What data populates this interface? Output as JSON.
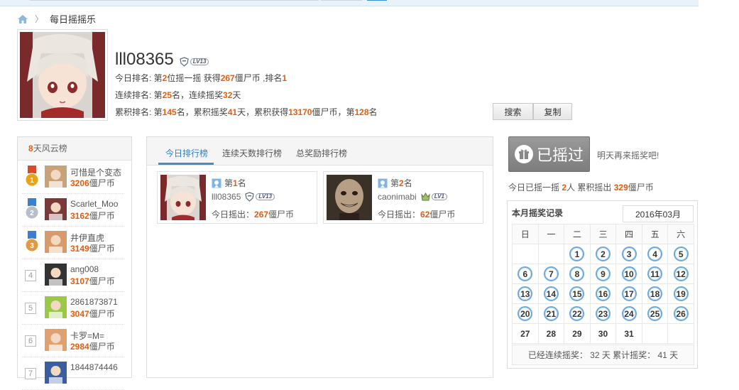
{
  "breadcrumb": {
    "current": "每日摇摇乐"
  },
  "profile": {
    "username": "lll08365",
    "level": "LV13",
    "today_rank_prefix": "今日排名: 第",
    "today_rank_pos": "2",
    "today_rank_mid": "位摇一摇 获得",
    "today_rank_coins": "267",
    "today_rank_suffix": "僵尸币 ,排名",
    "today_rank_no": "1",
    "streak_prefix": "连续排名: 第",
    "streak_rank": "25",
    "streak_mid": "名，连续摇奖",
    "streak_days": "32",
    "streak_suffix": "天",
    "total_prefix": "累积排名: 第",
    "total_rank": "145",
    "total_mid1": "名，累积摇奖",
    "total_days": "41",
    "total_mid2": "天，累积获得",
    "total_coins": "13170",
    "total_mid3": "僵尸币，第",
    "total_place": "128",
    "total_suffix": "名"
  },
  "buttons": {
    "search": "搜索",
    "copy": "复制"
  },
  "leaderboard": {
    "days": "8",
    "title_suffix": "天风云榜",
    "unit": "僵尸币",
    "items": [
      {
        "rank": "1",
        "name": "可惜是个变态",
        "coins": "3206",
        "medal": "gold"
      },
      {
        "rank": "2",
        "name": "Scarlet_Moo",
        "coins": "3162",
        "medal": "silver"
      },
      {
        "rank": "3",
        "name": "井伊直虎",
        "coins": "3149",
        "medal": "bronze"
      },
      {
        "rank": "4",
        "name": "ang008",
        "coins": "3107",
        "medal": ""
      },
      {
        "rank": "5",
        "name": "2861873871",
        "coins": "3047",
        "medal": ""
      },
      {
        "rank": "6",
        "name": "卡罗=M=",
        "coins": "2984",
        "medal": ""
      },
      {
        "rank": "7",
        "name": "1844874446",
        "coins": "",
        "medal": ""
      }
    ]
  },
  "tabs": {
    "today": "今日排行榜",
    "streak": "连续天数排行榜",
    "total": "总奖励排行榜"
  },
  "today_cards": [
    {
      "rank_prefix": "第",
      "rank": "1",
      "rank_suffix": "名",
      "name": "lll08365",
      "level": "LV13",
      "out_label": "今日摇出：",
      "coins": "267",
      "unit": "僵尸币"
    },
    {
      "rank_prefix": "第",
      "rank": "2",
      "rank_suffix": "名",
      "name": "caonimabi",
      "level": "LV1",
      "out_label": "今日摇出：",
      "coins": "62",
      "unit": "僵尸币"
    }
  ],
  "shake": {
    "done_label": "已摇过",
    "come_back": "明天再来摇奖吧!",
    "sum_prefix": "今日已摇一摇",
    "sum_people": "2",
    "sum_mid": "人 累积摇出",
    "sum_coins": "329",
    "sum_suffix": "僵尸币"
  },
  "calendar": {
    "title": "本月摇奖记录",
    "month": "2016年03月",
    "weekdays": [
      "日",
      "一",
      "二",
      "三",
      "四",
      "五",
      "六"
    ],
    "weeks": [
      [
        "",
        "",
        "1",
        "2",
        "3",
        "4",
        "5"
      ],
      [
        "6",
        "7",
        "8",
        "9",
        "10",
        "11",
        "12"
      ],
      [
        "13",
        "14",
        "15",
        "16",
        "17",
        "18",
        "19"
      ],
      [
        "20",
        "21",
        "22",
        "23",
        "24",
        "25",
        "26"
      ],
      [
        "27",
        "28",
        "29",
        "30",
        "31",
        "",
        ""
      ]
    ],
    "marked_through": 26,
    "footer": "已经连续摇奖： 32 天 累计摇奖： 41 天"
  },
  "colors": {
    "accent": "#e85b0c",
    "link": "#2f7fc4",
    "tab_underline": "#3a8ed3"
  }
}
